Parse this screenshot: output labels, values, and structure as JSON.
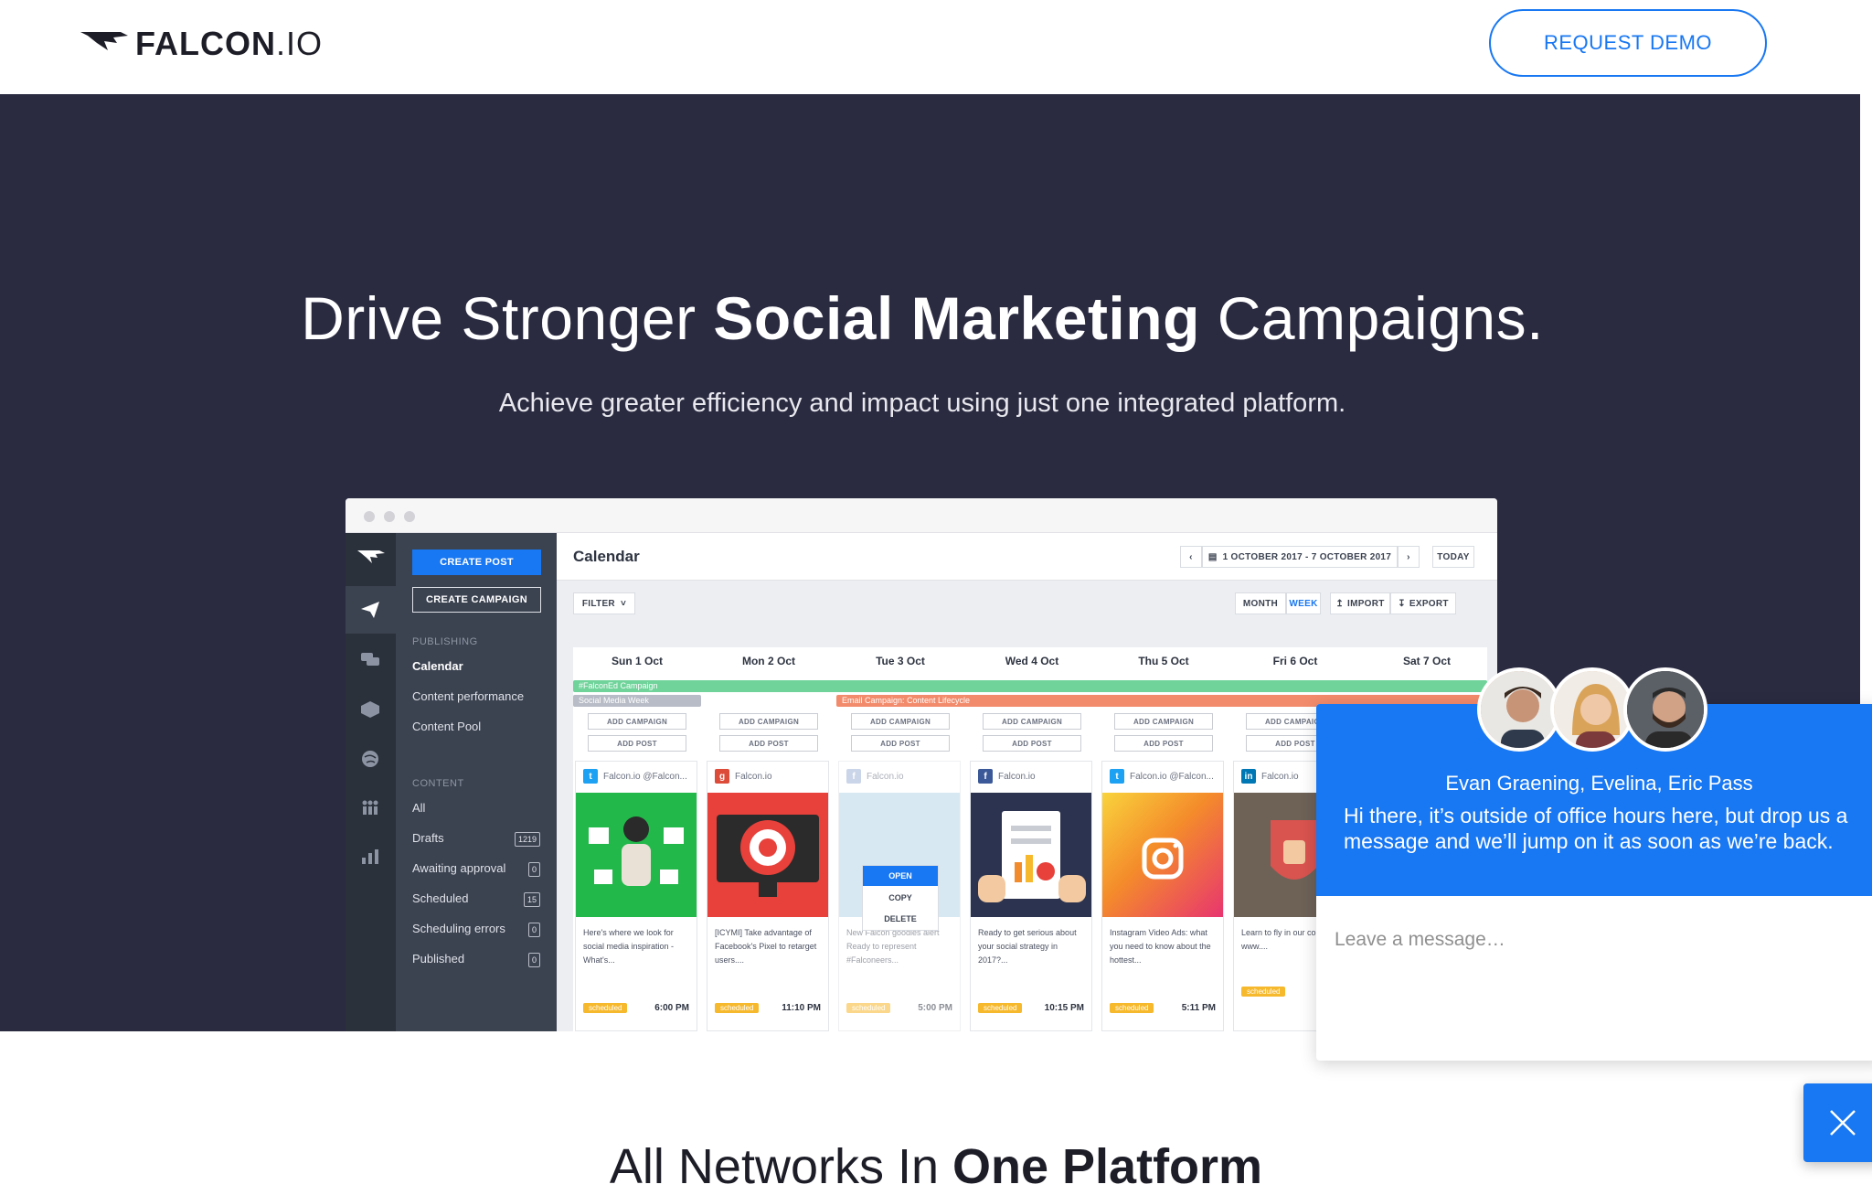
{
  "header": {
    "logo_bold": "FALCON",
    "logo_light": ".IO",
    "demo_button": "REQUEST DEMO"
  },
  "hero": {
    "title_pre": "Drive Stronger ",
    "title_bold": "Social Marketing",
    "title_post": " Campaigns.",
    "subtitle": "Achieve greater efficiency and impact using just one integrated platform."
  },
  "app": {
    "create_post": "CREATE POST",
    "create_campaign": "CREATE CAMPAIGN",
    "publishing_heading": "PUBLISHING",
    "publishing_items": [
      "Calendar",
      "Content performance",
      "Content Pool"
    ],
    "content_heading": "CONTENT",
    "content_items": [
      {
        "label": "All",
        "count": ""
      },
      {
        "label": "Drafts",
        "count": "1219"
      },
      {
        "label": "Awaiting approval",
        "count": "0"
      },
      {
        "label": "Scheduled",
        "count": "15"
      },
      {
        "label": "Scheduling errors",
        "count": "0"
      },
      {
        "label": "Published",
        "count": "0"
      }
    ],
    "page_title": "Calendar",
    "date_range": "1 OCTOBER 2017 - 7 OCTOBER 2017",
    "today": "TODAY",
    "filter": "FILTER",
    "month": "MONTH",
    "week": "WEEK",
    "import": "IMPORT",
    "export": "EXPORT",
    "days": [
      "Sun 1 Oct",
      "Mon 2 Oct",
      "Tue 3 Oct",
      "Wed 4 Oct",
      "Thu 5 Oct",
      "Fri 6 Oct",
      "Sat 7 Oct"
    ],
    "bands": {
      "falconed": "#FalconEd Campaign",
      "smw": "Social Media Week",
      "email": "Email Campaign: Content Lifecycle"
    },
    "add_campaign": "ADD CAMPAIGN",
    "add_post": "ADD POST",
    "open": "OPEN",
    "copy": "COPY",
    "delete": "DELETE",
    "tag": "scheduled",
    "cards": [
      {
        "network": "twitter",
        "account": "Falcon.io @Falcon...",
        "text": "Here's where we look for social media inspiration - What's...",
        "time": "6:00 PM"
      },
      {
        "network": "google-plus",
        "account": "Falcon.io",
        "text": "[ICYMI] Take advantage of Facebook's Pixel to retarget users....",
        "time": "11:10 PM"
      },
      {
        "network": "facebook",
        "account": "Falcon.io",
        "text": "New Falcon goodies alert Ready to represent #Falconeers...",
        "time": "5:00 PM"
      },
      {
        "network": "facebook",
        "account": "Falcon.io",
        "text": "Ready to get serious about your social strategy in 2017?...",
        "time": "10:15 PM"
      },
      {
        "network": "twitter",
        "account": "Falcon.io @Falcon...",
        "text": "Instagram Video Ads: what you need to know about the hottest...",
        "time": "5:11 PM"
      },
      {
        "network": "linkedin",
        "account": "Falcon.io",
        "text": "Learn to fly in our course: www....",
        "time": ""
      }
    ]
  },
  "chat": {
    "names": "Evan Graening, Evelina, Eric Pass",
    "message": "Hi there, it’s outside of office hours here, but drop us a message and we’ll jump on it as soon as we’re back.",
    "placeholder": "Leave a message…"
  },
  "section": {
    "title_pre": "All Networks In ",
    "title_bold": "One Platform"
  },
  "colors": {
    "accent": "#1877f2",
    "hero_bg": "#2a2a41",
    "band_green": "#6fd39a",
    "band_orange": "#f28b6b",
    "band_gray": "#b7bcc6",
    "tag_yellow": "#f6b82c"
  }
}
